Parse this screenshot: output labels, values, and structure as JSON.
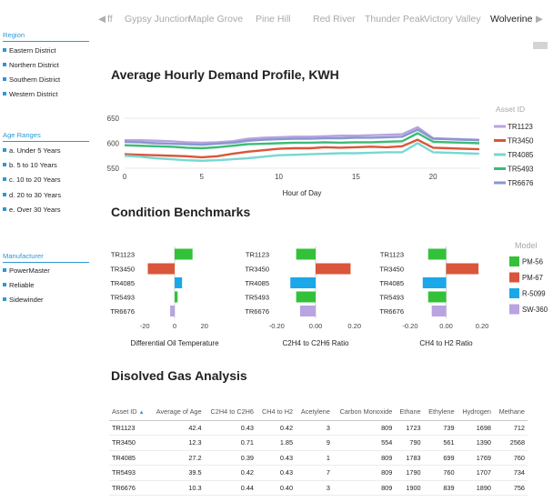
{
  "sidebar": {
    "region": {
      "title": "Region",
      "items": [
        "Eastern District",
        "Northern District",
        "Southern District",
        "Western District"
      ]
    },
    "age": {
      "title": "Age Ranges",
      "items": [
        "a. Under 5 Years",
        "b. 5 to 10 Years",
        "c. 10 to 20 Years",
        "d. 20 to 30 Years",
        "e. Over 30 Years"
      ]
    },
    "manufacturer": {
      "title": "Manufacturer",
      "items": [
        "PowerMaster",
        "Reliable",
        "Sidewinder"
      ]
    }
  },
  "tabs": {
    "prev_label": "◀",
    "partial_label": "ff",
    "items": [
      "Gypsy Junction",
      "Maple Grove",
      "Pine Hill",
      "Red River",
      "Thunder Peak",
      "Victory Valley",
      "Wolverine"
    ],
    "active": "Wolverine",
    "next_label": "▶"
  },
  "colors": {
    "accent": "#2c98d6",
    "TR1123": "#b9a3e0",
    "TR3450": "#d9563a",
    "TR4085": "#76d9d1",
    "TR5493": "#3dbb76",
    "TR6676": "#8898cf",
    "PM-56": "#33c13a",
    "PM-67": "#d9563a",
    "R-5099": "#1aa8e8",
    "SW-360": "#b9a3e0"
  },
  "sections": {
    "demand": "Average Hourly Demand Profile, KWH",
    "bench": "Condition Benchmarks",
    "gas": "Disolved Gas Analysis"
  },
  "chart_data": [
    {
      "type": "line",
      "title": "Average Hourly Demand Profile, KWH",
      "xlabel": "Hour of Day",
      "ylabel": "",
      "xlim": [
        0,
        23
      ],
      "ylim": [
        550,
        650
      ],
      "xticks": [
        0,
        5,
        10,
        15,
        20
      ],
      "yticks": [
        550,
        600,
        650
      ],
      "legend_title": "Asset ID",
      "legend_position": "right",
      "x": [
        0,
        1,
        2,
        3,
        4,
        5,
        6,
        7,
        8,
        9,
        10,
        11,
        12,
        13,
        14,
        15,
        16,
        17,
        18,
        19,
        20,
        21,
        22,
        23
      ],
      "series": [
        {
          "name": "TR1123",
          "values": [
            606,
            606,
            605,
            604,
            602,
            601,
            602,
            604,
            609,
            611,
            612,
            613,
            613,
            614,
            615,
            615,
            616,
            617,
            618,
            632,
            610,
            609,
            608,
            607
          ]
        },
        {
          "name": "TR3450",
          "values": [
            578,
            577,
            576,
            575,
            574,
            572,
            574,
            579,
            583,
            586,
            589,
            590,
            590,
            592,
            591,
            592,
            593,
            592,
            594,
            607,
            591,
            590,
            589,
            588
          ]
        },
        {
          "name": "TR4085",
          "values": [
            575,
            573,
            570,
            568,
            566,
            565,
            566,
            568,
            570,
            573,
            576,
            577,
            578,
            579,
            580,
            580,
            581,
            582,
            582,
            600,
            582,
            581,
            580,
            579
          ]
        },
        {
          "name": "TR5493",
          "values": [
            596,
            595,
            594,
            593,
            591,
            590,
            592,
            595,
            598,
            599,
            600,
            601,
            601,
            602,
            601,
            602,
            602,
            603,
            604,
            620,
            603,
            602,
            601,
            600
          ]
        },
        {
          "name": "TR6676",
          "values": [
            603,
            602,
            600,
            599,
            598,
            597,
            599,
            601,
            605,
            607,
            608,
            609,
            609,
            610,
            610,
            611,
            611,
            612,
            613,
            627,
            609,
            608,
            607,
            606
          ]
        }
      ]
    },
    {
      "type": "bar",
      "orientation": "horizontal",
      "xlabel": "Differential Oil Temperature",
      "categories": [
        "TR1123",
        "TR3450",
        "TR4085",
        "TR5493",
        "TR6676"
      ],
      "values": [
        12,
        -18,
        5,
        2,
        -3
      ],
      "xlim": [
        -25,
        25
      ],
      "xticks": [
        -20,
        0,
        20
      ]
    },
    {
      "type": "bar",
      "orientation": "horizontal",
      "xlabel": "C2H4 to C2H6 Ratio",
      "categories": [
        "TR1123",
        "TR3450",
        "TR4085",
        "TR5493",
        "TR6676"
      ],
      "values": [
        -0.1,
        0.18,
        -0.13,
        -0.1,
        -0.08
      ],
      "xlim": [
        -0.22,
        0.22
      ],
      "xticks": [
        -0.2,
        0.0,
        0.2
      ],
      "xtick_labels": [
        "-0.20",
        "0.00",
        "0.20"
      ]
    },
    {
      "type": "bar",
      "orientation": "horizontal",
      "xlabel": "CH4 to H2 Ratio",
      "categories": [
        "TR1123",
        "TR3450",
        "TR4085",
        "TR5493",
        "TR6676"
      ],
      "values": [
        -0.1,
        0.18,
        -0.13,
        -0.1,
        -0.08
      ],
      "xlim": [
        -0.22,
        0.22
      ],
      "xticks": [
        -0.2,
        0.0,
        0.2
      ],
      "xtick_labels": [
        "-0.20",
        "0.00",
        "0.20"
      ],
      "legend_title": "Model",
      "legend_position": "right",
      "legend": [
        "PM-56",
        "PM-67",
        "R-5099",
        "SW-360"
      ],
      "bar_models": [
        "PM-56",
        "PM-67",
        "R-5099",
        "PM-56",
        "SW-360"
      ]
    }
  ],
  "table": {
    "sort_indicator": "▲",
    "headers": [
      "Asset ID",
      "Average of Age",
      "C2H4 to C2H6",
      "CH4 to H2",
      "Acetylene",
      "Carbon Monoxide",
      "Ethane",
      "Ethylene",
      "Hydrogen",
      "Methane"
    ],
    "rows": [
      [
        "TR1123",
        "42.4",
        "0.43",
        "0.42",
        "3",
        "809",
        "1723",
        "739",
        "1698",
        "712"
      ],
      [
        "TR3450",
        "12.3",
        "0.71",
        "1.85",
        "9",
        "554",
        "790",
        "561",
        "1390",
        "2568"
      ],
      [
        "TR4085",
        "27.2",
        "0.39",
        "0.43",
        "1",
        "809",
        "1783",
        "699",
        "1769",
        "760"
      ],
      [
        "TR5493",
        "39.5",
        "0.42",
        "0.43",
        "7",
        "809",
        "1790",
        "760",
        "1707",
        "734"
      ],
      [
        "TR6676",
        "10.3",
        "0.44",
        "0.40",
        "3",
        "809",
        "1900",
        "839",
        "1890",
        "756"
      ]
    ]
  }
}
